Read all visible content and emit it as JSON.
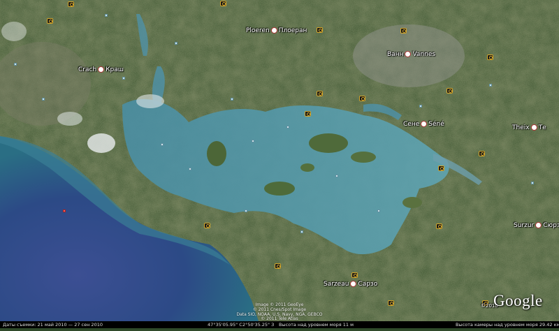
{
  "map": {
    "places": [
      {
        "id": "crach",
        "text": "Crach",
        "text2": "Краш"
      },
      {
        "id": "ploeren",
        "text": "Ploeren",
        "text2": "Плоеран"
      },
      {
        "id": "vannes",
        "text": "Ванн",
        "text2": "Vannes"
      },
      {
        "id": "sene",
        "text": "Сене",
        "text2": "Séné"
      },
      {
        "id": "theix",
        "text": "Theix",
        "text2": "Те"
      },
      {
        "id": "surzur",
        "text": "Surzur",
        "text2": "Сюрзур"
      },
      {
        "id": "sarzeau",
        "text": "Sarzeau",
        "text2": "Сарзо"
      }
    ],
    "credits": [
      "Image © 2011 GeoEye",
      "© 2011 Cnes/Spot Image",
      "Data SIO, NOAA, U.S. Navy, NGA, GEBCO",
      "© 2011 Tele Atlas"
    ],
    "copyright_year": "©2010"
  },
  "logo": {
    "text": "Google"
  },
  "status_bar": {
    "imagery_dates": "Даты съемки: 21 май 2010 — 27 сен 2010",
    "coords_lat": "47°35'05.95\" С",
    "coords_lon": "2°50'35.25\" З",
    "elevation": "Высота над уровнем моря   11 м",
    "eye_alt": "Высота камеры над уровнем моря   29.42 км"
  }
}
